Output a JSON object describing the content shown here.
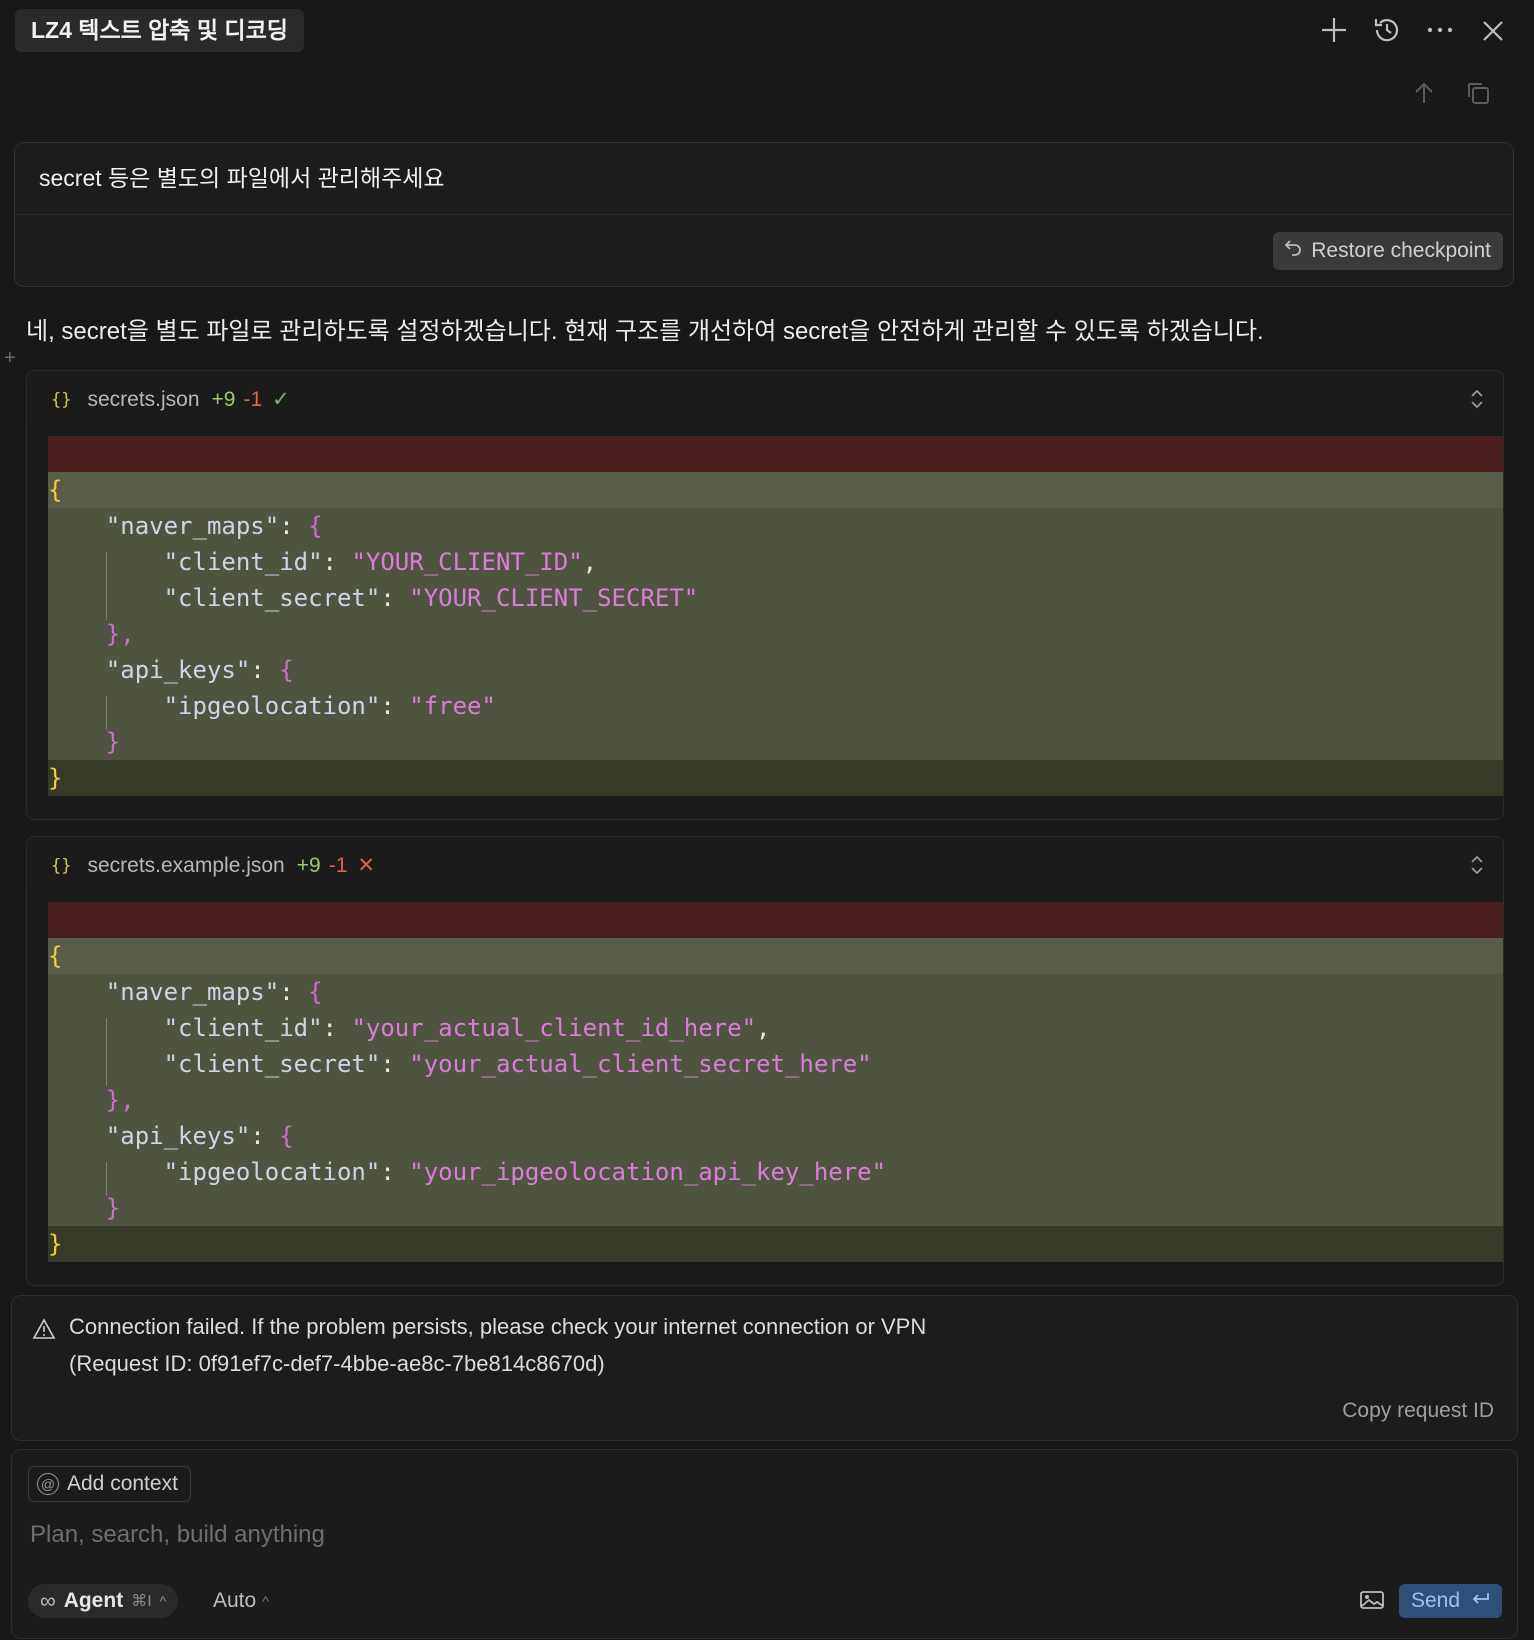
{
  "header": {
    "title": "LZ4 텍스트 압축 및 디코딩",
    "icons": [
      "plus-icon",
      "history-icon",
      "more-icon",
      "close-icon"
    ],
    "sub_icons": [
      "arrow-up-icon",
      "copy-icon"
    ]
  },
  "user_message": {
    "text": "secret 등은 별도의 파일에서 관리해주세요",
    "restore_label": "Restore checkpoint"
  },
  "assistant": {
    "text": "네, secret을 별도 파일로 관리하도록 설정하겠습니다. 현재 구조를 개선하여 secret을 안전하게 관리할 수 있도록 하겠습니다."
  },
  "files": [
    {
      "filename": "secrets.json",
      "added": "+9",
      "removed": "-1",
      "status": "accepted",
      "status_glyph": "✓",
      "values": {
        "client_id": "\"YOUR_CLIENT_ID\"",
        "client_secret": "\"YOUR_CLIENT_SECRET\"",
        "ipgeolocation": "\"free\""
      }
    },
    {
      "filename": "secrets.example.json",
      "added": "+9",
      "removed": "-1",
      "status": "rejected",
      "status_glyph": "✕",
      "values": {
        "client_id": "\"your_actual_client_id_here\"",
        "client_secret": "\"your_actual_client_secret_here\"",
        "ipgeolocation": "\"your_ipgeolocation_api_key_here\""
      }
    }
  ],
  "code_tokens": {
    "open_brace": "{",
    "close_brace": "}",
    "close_brace_comma": "},",
    "naver_maps_key": "\"naver_maps\"",
    "client_id_key": "\"client_id\"",
    "client_secret_key": "\"client_secret\"",
    "api_keys_key": "\"api_keys\"",
    "ipgeolocation_key": "\"ipgeolocation\"",
    "colon": ": ",
    "comma": ","
  },
  "error": {
    "line1": "Connection failed. If the problem persists, please check your internet connection or VPN",
    "line2": "(Request ID: 0f91ef7c-def7-4bbe-ae8c-7be814c8670d)",
    "copy_label": "Copy request ID"
  },
  "composer": {
    "add_context_label": "Add context",
    "placeholder": "Plan, search, build anything",
    "agent_label": "Agent",
    "agent_shortcut": "⌘I",
    "model_label": "Auto",
    "send_label": "Send"
  },
  "colors": {
    "background": "#181818",
    "deleted_line": "#4a1e1e",
    "added_line": "#4f5441",
    "string": "#d97ed8",
    "send_button": "#2d4f78"
  }
}
